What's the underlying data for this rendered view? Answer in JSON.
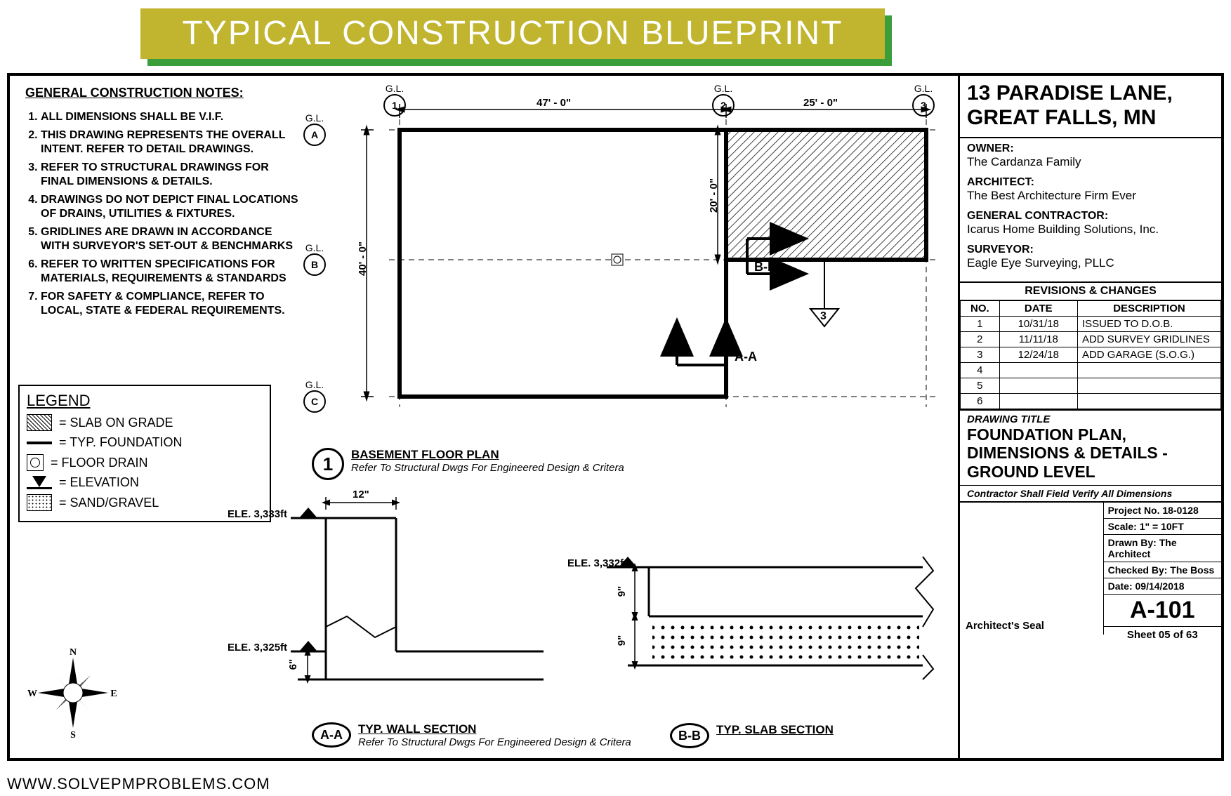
{
  "banner": "TYPICAL CONSTRUCTION BLUEPRINT",
  "notes": {
    "title": "GENERAL CONSTRUCTION NOTES:",
    "items": [
      "ALL DIMENSIONS SHALL BE V.I.F.",
      "THIS DRAWING REPRESENTS THE OVERALL INTENT. REFER TO DETAIL DRAWINGS.",
      "REFER TO STRUCTURAL DRAWINGS FOR FINAL DIMENSIONS & DETAILS.",
      "DRAWINGS DO NOT DEPICT FINAL LOCATIONS OF DRAINS, UTILITIES & FIXTURES.",
      "GRIDLINES ARE DRAWN IN ACCORDANCE WITH SURVEYOR'S SET-OUT & BENCHMARKS",
      "REFER TO WRITTEN SPECIFICATIONS FOR MATERIALS, REQUIREMENTS & STANDARDS",
      "FOR SAFETY & COMPLIANCE, REFER TO LOCAL, STATE & FEDERAL REQUIREMENTS."
    ]
  },
  "legend": {
    "title": "LEGEND",
    "items": [
      "= SLAB ON GRADE",
      "= TYP. FOUNDATION",
      "= FLOOR DRAIN",
      "= ELEVATION",
      "= SAND/GRAVEL"
    ]
  },
  "floorplan": {
    "gridlines": {
      "gl1": "G.L. 1",
      "gl2": "G.L. 2",
      "gl3": "G.L. 3",
      "gla": "G.L. A",
      "glb": "G.L. B",
      "glc": "G.L. C"
    },
    "dims": {
      "w1": "47' - 0\"",
      "w2": "25' - 0\"",
      "h1": "20' - 0\"",
      "h2": "40' - 0\""
    },
    "sections": {
      "aa": "A-A",
      "bb": "B-B"
    },
    "detail_ref": "3",
    "callout": {
      "num": "1",
      "title": "BASEMENT FLOOR PLAN",
      "sub": "Refer To Structural Dwgs For Engineered Design & Critera"
    }
  },
  "wall_section": {
    "label": "A-A",
    "title": "TYP. WALL SECTION",
    "sub": "Refer To Structural Dwgs For Engineered Design & Critera",
    "dim_w": "12\"",
    "dim_h": "6\"",
    "elev_top": "ELE. 3,333ft",
    "elev_bot": "ELE. 3,325ft"
  },
  "slab_section": {
    "label": "B-B",
    "title": "TYP. SLAB SECTION",
    "elev": "ELE. 3,332ft",
    "dim_top": "9\"",
    "dim_bot": "9\""
  },
  "title_block": {
    "address": "13 PARADISE LANE, GREAT FALLS, MN",
    "owner_lbl": "OWNER:",
    "owner": "The Cardanza Family",
    "architect_lbl": "ARCHITECT:",
    "architect": "The Best Architecture Firm Ever",
    "gc_lbl": "GENERAL CONTRACTOR:",
    "gc": "Icarus Home Building Solutions, Inc.",
    "surveyor_lbl": "SURVEYOR:",
    "surveyor": "Eagle Eye Surveying, PLLC",
    "rev_title": "REVISIONS & CHANGES",
    "rev_headers": [
      "NO.",
      "DATE",
      "DESCRIPTION"
    ],
    "revisions": [
      {
        "no": "1",
        "date": "10/31/18",
        "desc": "ISSUED TO D.O.B."
      },
      {
        "no": "2",
        "date": "11/11/18",
        "desc": "ADD SURVEY GRIDLINES"
      },
      {
        "no": "3",
        "date": "12/24/18",
        "desc": "ADD GARAGE (S.O.G.)"
      },
      {
        "no": "4",
        "date": "",
        "desc": ""
      },
      {
        "no": "5",
        "date": "",
        "desc": ""
      },
      {
        "no": "6",
        "date": "",
        "desc": ""
      }
    ],
    "dtitle_lbl": "DRAWING TITLE",
    "dtitle": "FOUNDATION PLAN, DIMENSIONS & DETAILS - GROUND LEVEL",
    "verify": "Contractor Shall Field Verify All Dimensions",
    "seal_lbl": "Architect's Seal",
    "proj_no": "Project No. 18-0128",
    "scale": "Scale: 1\" = 10FT",
    "drawn": "Drawn By: The Architect",
    "checked": "Checked By: The Boss",
    "date": "Date: 09/14/2018",
    "sheet_no": "A-101",
    "sheet_of": "Sheet 05 of 63"
  },
  "footer": "WWW.SOLVEPMPROBLEMS.COM",
  "compass": {
    "n": "N",
    "e": "E",
    "s": "S",
    "w": "W"
  }
}
